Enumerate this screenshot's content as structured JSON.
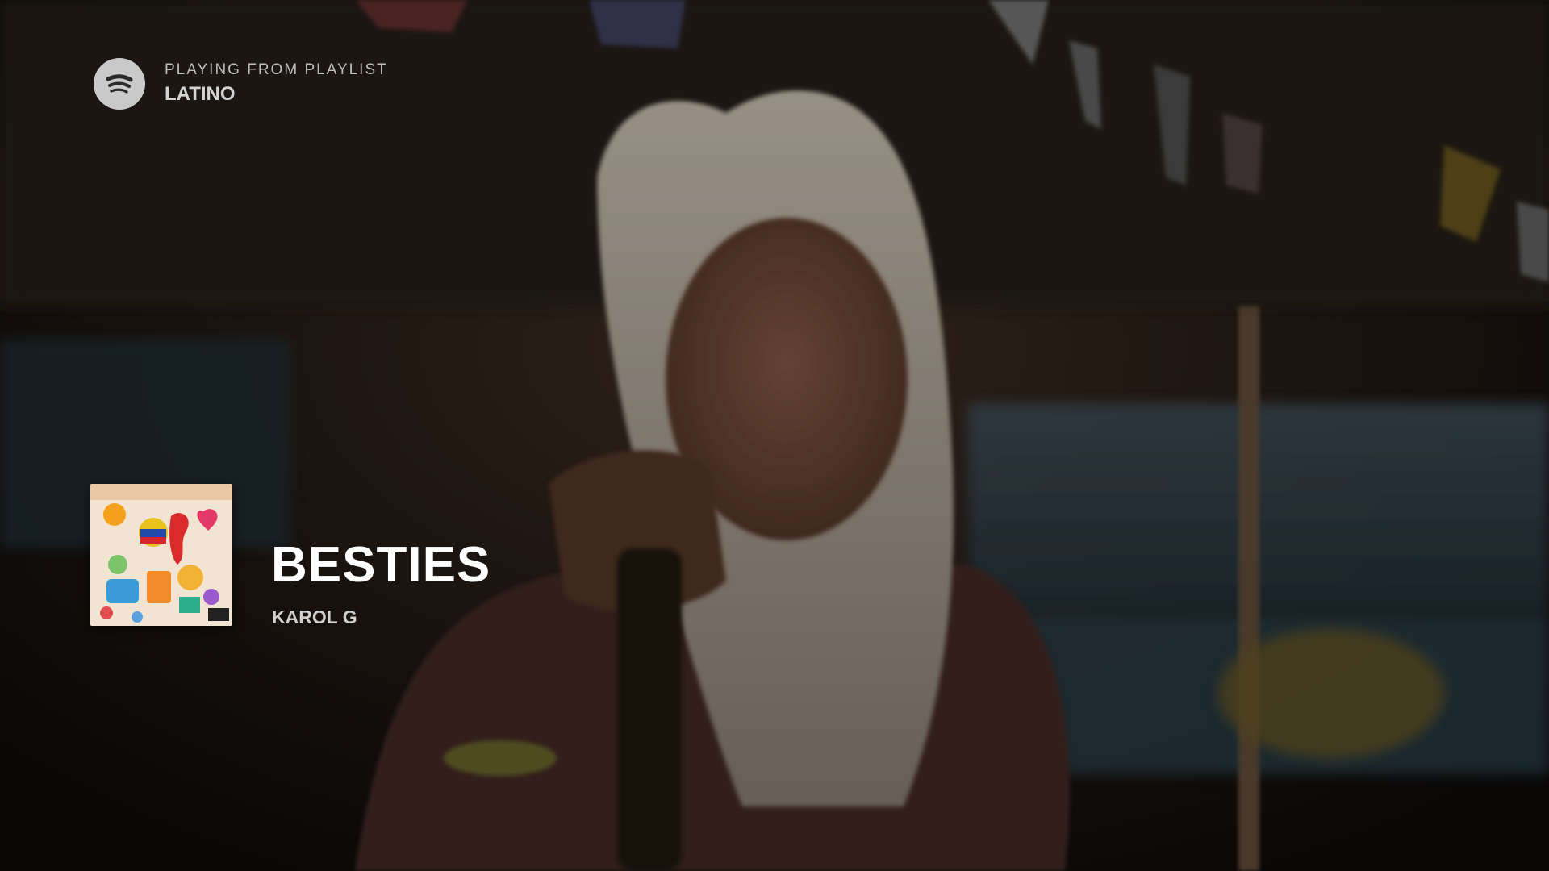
{
  "now_playing_context": {
    "label": "PLAYING FROM PLAYLIST",
    "name": "LATINO"
  },
  "track": {
    "title": "BESTIES",
    "artist": "KAROL G"
  },
  "icons": {
    "logo": "spotify-logo-icon"
  },
  "colors": {
    "title": "#ffffff",
    "secondary_text": "#cfcfcf",
    "logo": "#c9c9c9"
  }
}
